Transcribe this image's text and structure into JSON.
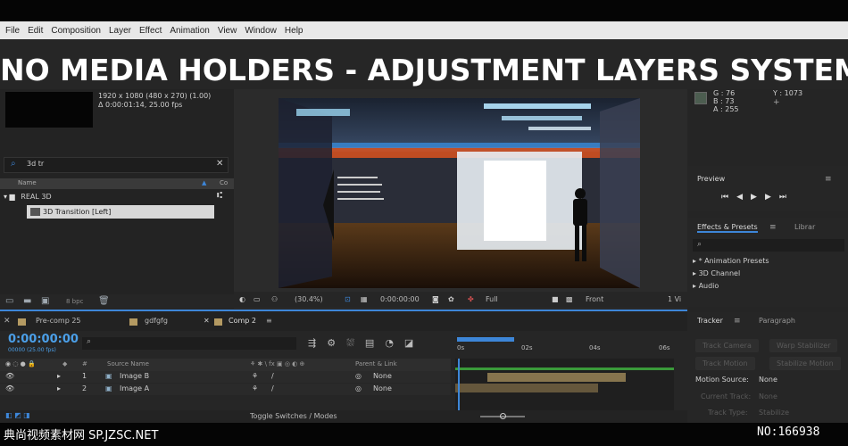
{
  "menu": [
    "File",
    "Edit",
    "Composition",
    "Layer",
    "Effect",
    "Animation",
    "View",
    "Window",
    "Help"
  ],
  "banner_title": "NO MEDIA HOLDERS - ADJUSTMENT LAYERS SYSTEM",
  "project": {
    "meta_line1": "1920 x 1080  (480 x 270) (1.00)",
    "meta_line2": "Δ 0:00:01:14, 25.00 fps",
    "search_value": "3d tr",
    "col_name": "Name",
    "col_comment": "Co",
    "folder": "REAL 3D",
    "item": "3D Transition [Left]",
    "bpc": "8 bpc"
  },
  "viewer": {
    "zoom": "(30.4%)",
    "timecode": "0:00:00:00",
    "resolution": "Full",
    "camera": "Front",
    "views": "1 Vi"
  },
  "info": {
    "g": "G : 76",
    "b": "B : 73",
    "a": "A : 255",
    "y": "Y : 1073"
  },
  "preview": {
    "title": "Preview"
  },
  "effects": {
    "title": "Effects & Presets",
    "library_tab": "Librar",
    "items": [
      "* Animation Presets",
      "3D Channel",
      "Audio"
    ]
  },
  "tracker": {
    "title": "Tracker",
    "paragraph_tab": "Paragraph",
    "track_camera": "Track Camera",
    "warp_stabilizer": "Warp Stabilizer",
    "track_motion": "Track Motion",
    "stabilize_motion": "Stabilize Motion",
    "motion_source_label": "Motion Source:",
    "motion_source_value": "None",
    "current_track_label": "Current Track:",
    "current_track_value": "None",
    "track_type_label": "Track Type:",
    "track_type_value": "Stabilize"
  },
  "timeline": {
    "tabs": [
      "Pre-comp 25",
      "gdfgfg",
      "Comp 2"
    ],
    "timecode": "0:00:00:00",
    "fps": "00000 (25.00 fps)",
    "col_source": "Source Name",
    "col_parent": "Parent & Link",
    "layers": [
      {
        "num": "1",
        "name": "Image B",
        "parent": "None"
      },
      {
        "num": "2",
        "name": "Image A",
        "parent": "None"
      }
    ],
    "ruler": [
      "0s",
      "02s",
      "04s",
      "06s"
    ],
    "footer": "Toggle Switches / Modes"
  },
  "watermark": {
    "left": "典尚视频素材网 SP.JZSC.NET",
    "right": "NO:166938"
  },
  "colors": {
    "accent": "#3d86d8",
    "timecode": "#4b9fe8",
    "tab_label": "#b49a62"
  }
}
